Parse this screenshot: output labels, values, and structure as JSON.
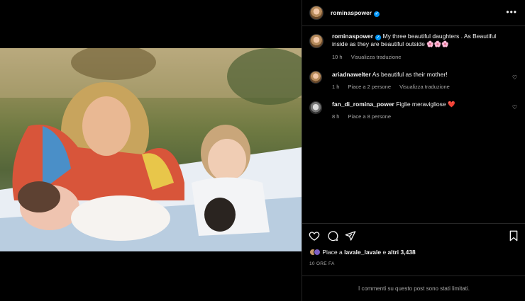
{
  "post": {
    "author": "rominaspower",
    "caption": "My three beautiful daughters . As Beautiful inside as they are beautiful outside 🌸🌸🌸",
    "caption_time": "10 h",
    "caption_translate": "Visualizza traduzione"
  },
  "comments": [
    {
      "user": "ariadnawelter",
      "text": "As beautiful as their mother!",
      "time": "1 h",
      "likes": "Piace a 2 persone",
      "translate": "Visualizza traduzione"
    },
    {
      "user": "fan_di_romina_power",
      "text": "Figlie meravigliose ❤️",
      "time": "8 h",
      "likes": "Piace a 8 persone"
    }
  ],
  "likes": {
    "prefix": "Piace a ",
    "user": "lavale_lavale",
    "middle": " e ",
    "others": "altri 3,438"
  },
  "time_ago": "10 ORE FA",
  "comments_limited": "I commenti su questo post sono stati limitati.",
  "colors": {
    "verified": "#0095f6",
    "background": "#000000",
    "divider": "#262626",
    "muted": "#a8a8a8"
  },
  "icons": [
    "more-icon",
    "heart-icon",
    "comment-icon",
    "share-icon",
    "bookmark-icon",
    "verified-icon"
  ]
}
